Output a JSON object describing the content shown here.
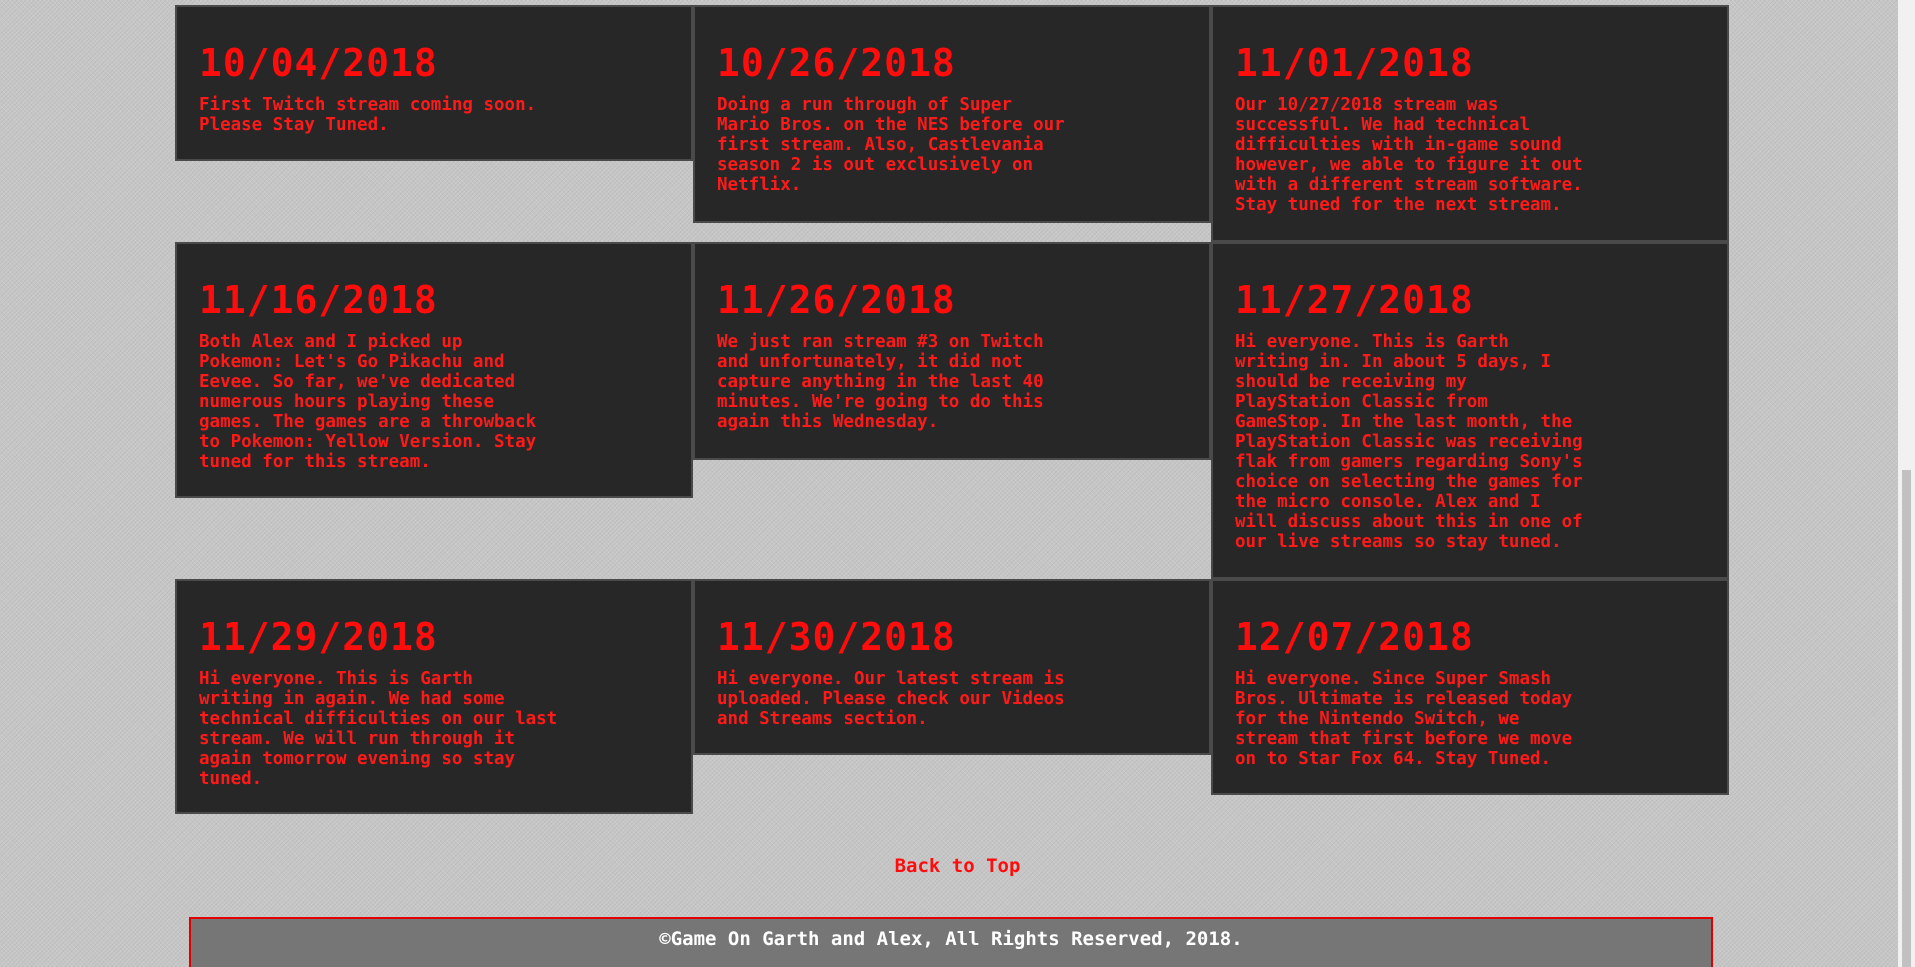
{
  "news": [
    {
      "date": "10/04/2018",
      "text": "First Twitch stream coming soon.\nPlease Stay Tuned."
    },
    {
      "date": "10/26/2018",
      "text": "Doing a run through of Super\nMario Bros. on the NES before our\nfirst stream. Also, Castlevania\nseason 2 is out exclusively on\nNetflix."
    },
    {
      "date": "11/01/2018",
      "text": "Our 10/27/2018 stream was\nsuccessful. We had technical\ndifficulties with in-game sound\nhowever, we able to figure it out\nwith a different stream software.\nStay tuned for the next stream."
    },
    {
      "date": "11/16/2018",
      "text": "Both Alex and I picked up\nPokemon: Let's Go Pikachu and\nEevee. So far, we've dedicated\nnumerous hours playing these\ngames. The games are a throwback\nto Pokemon: Yellow Version. Stay\ntuned for this stream."
    },
    {
      "date": "11/26/2018",
      "text": "We just ran stream #3 on Twitch\nand unfortunately, it did not\ncapture anything in the last 40\nminutes. We're going to do this\nagain this Wednesday."
    },
    {
      "date": "11/27/2018",
      "text": "Hi everyone. This is Garth\nwriting in. In about 5 days, I\nshould be receiving my\nPlayStation Classic from\nGameStop. In the last month, the\nPlayStation Classic was receiving\nflak from gamers regarding Sony's\nchoice on selecting the games for\nthe micro console. Alex and I\nwill discuss about this in one of\nour live streams so stay tuned."
    },
    {
      "date": "11/29/2018",
      "text": "Hi everyone. This is Garth\nwriting in again. We had some\ntechnical difficulties on our last\nstream. We will run through it\nagain tomorrow evening so stay\ntuned."
    },
    {
      "date": "11/30/2018",
      "text": "Hi everyone. Our latest stream is\nuploaded. Please check our Videos\nand Streams section."
    },
    {
      "date": "12/07/2018",
      "text": "Hi everyone. Since Super Smash\nBros. Ultimate is released today\nfor the Nintendo Switch, we\nstream that first before we move\non to Star Fox 64. Stay Tuned."
    }
  ],
  "back_to_top": "Back to Top",
  "footer": {
    "copyright": "©Game On Garth and Alex, All Rights Reserved, 2018."
  },
  "colors": {
    "page_background": "#c6c6c6",
    "card_background": "#272727",
    "accent_red": "#ff0d0d",
    "footer_background": "#767676"
  }
}
